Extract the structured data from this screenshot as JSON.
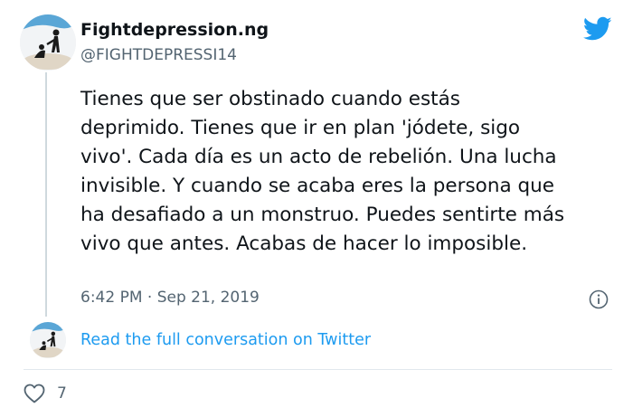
{
  "author": {
    "name": "Fightdepression.ng",
    "handle": "@FIGHTDEPRESSI14",
    "avatar": "avatar-icon"
  },
  "tweet": {
    "lines": [
      "Tienes que ser obstinado cuando estás",
      "deprimido. Tienes que ir en plan 'jódete, sigo",
      "vivo'. Cada día es un acto de rebelión. Una lucha",
      "invisible. Y cuando se acaba eres la persona que",
      "ha desafiado a un monstruo. Puedes sentirte más",
      "vivo que antes. Acabas de hacer lo imposible."
    ],
    "timestamp": "6:42 PM · Sep 21, 2019"
  },
  "footer": {
    "conversation_link": "Read the full conversation on Twitter",
    "like_count": "7"
  },
  "icons": {
    "brand": "twitter-bird-icon",
    "info": "info-icon",
    "like": "heart-icon"
  },
  "colors": {
    "brand": "#1d9bf0",
    "text": "#0f1419",
    "muted": "#536471"
  }
}
